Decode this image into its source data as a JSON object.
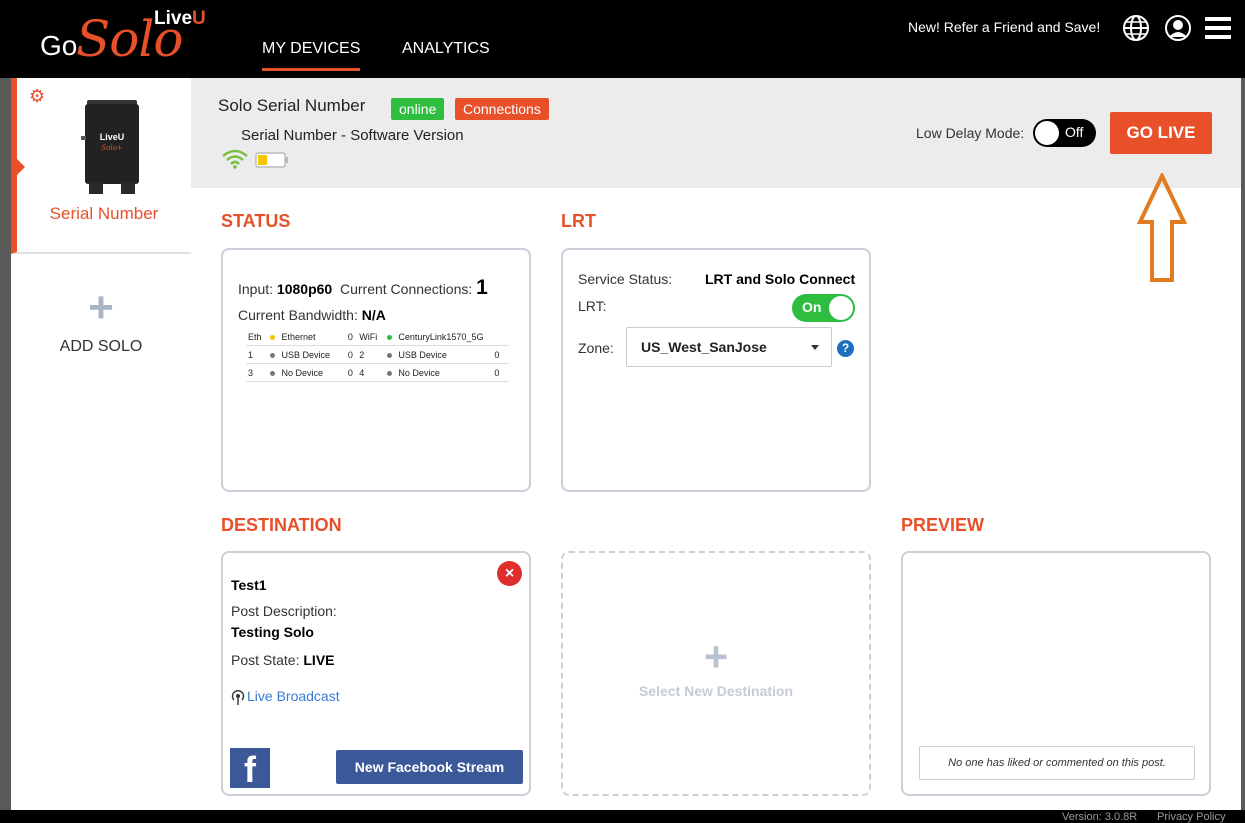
{
  "header": {
    "logo_go": "Go",
    "logo_solo": "Solo",
    "logo_live": "Live",
    "logo_u": "U",
    "tabs": [
      {
        "label": "MY DEVICES",
        "active": true
      },
      {
        "label": "ANALYTICS",
        "active": false
      }
    ],
    "refer_text": "New! Refer a Friend and Save!",
    "icons": [
      "globe-icon",
      "user-icon",
      "hamburger-menu-icon"
    ]
  },
  "sidebar": {
    "device_name": "Serial Number",
    "device_logo_text": "LiveU",
    "device_sub_text": "Solo+",
    "add_plus": "+",
    "add_label": "ADD SOLO"
  },
  "topbar": {
    "title": "Solo Serial Number",
    "badge_online": "online",
    "badge_connections": "Connections",
    "subtitle": "Serial Number - Software Version",
    "low_delay_label": "Low Delay Mode:",
    "low_delay_state": "Off",
    "go_live_label": "GO LIVE",
    "battery_level": 0.35
  },
  "status": {
    "title": "STATUS",
    "input_label": "Input:",
    "input_value": "1080p60",
    "connections_label": "Current Connections:",
    "connections_value": "1",
    "bandwidth_label": "Current Bandwidth:",
    "bandwidth_value": "N/A",
    "modems": [
      {
        "id_a": "Eth",
        "color_a": "#f2c700",
        "name_a": "Ethernet",
        "val_a": "0",
        "id_b": "WiFi",
        "color_b": "#2ebd3f",
        "name_b": "CenturyLink1570_5G",
        "val_b": ""
      },
      {
        "id_a": "1",
        "color_a": "#777777",
        "name_a": "USB Device",
        "val_a": "0",
        "id_b": "2",
        "color_b": "#777777",
        "name_b": "USB Device",
        "val_b": "0"
      },
      {
        "id_a": "3",
        "color_a": "#777777",
        "name_a": "No Device",
        "val_a": "0",
        "id_b": "4",
        "color_b": "#777777",
        "name_b": "No Device",
        "val_b": "0"
      }
    ]
  },
  "lrt": {
    "title": "LRT",
    "service_status_label": "Service Status:",
    "service_status_value": "LRT and Solo Connect",
    "lrt_label": "LRT:",
    "lrt_toggle": "On",
    "zone_label": "Zone:",
    "zone_value": "US_West_SanJose",
    "help": "?"
  },
  "destination": {
    "title": "DESTINATION",
    "close": "×",
    "name": "Test1",
    "post_desc_label": "Post Description:",
    "post_desc_value": "Testing Solo",
    "post_state_label": "Post State:",
    "post_state_value": "LIVE",
    "live_link": "Live Broadcast",
    "fb_logo": "f",
    "fb_button": "New Facebook Stream",
    "new_plus": "+",
    "new_label": "Select New Destination"
  },
  "preview": {
    "title": "PREVIEW",
    "note": "No one has liked or commented on this post."
  },
  "footer": {
    "version": "Version: 3.0.8R",
    "privacy": "Privacy Policy"
  },
  "colors": {
    "accent": "#e8502a",
    "online": "#2ebd3f",
    "facebook": "#3b5998",
    "link": "#3a7bd5"
  }
}
